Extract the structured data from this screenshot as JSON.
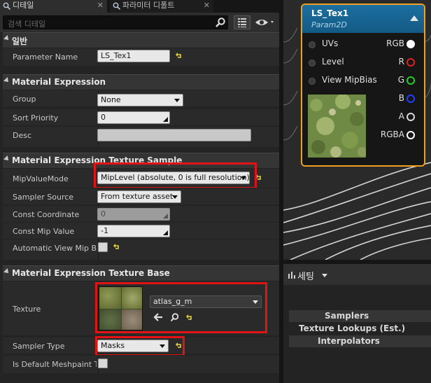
{
  "tabs": [
    {
      "label": "디테일",
      "active": true
    },
    {
      "label": "파라미터 디폴트",
      "active": false
    }
  ],
  "search": {
    "placeholder": "검색 디테일"
  },
  "categories": {
    "general": "일반",
    "expression": "Material Expression",
    "texture_sample": "Material Expression Texture Sample",
    "texture_base": "Material Expression Texture Base"
  },
  "props": {
    "parameter_name": {
      "label": "Parameter Name",
      "value": "LS_Tex1"
    },
    "group": {
      "label": "Group",
      "value": "None"
    },
    "sort_priority": {
      "label": "Sort Priority",
      "value": "0"
    },
    "desc": {
      "label": "Desc",
      "value": ""
    },
    "mip_value_mode": {
      "label": "MipValueMode",
      "value": "MipLevel (absolute, 0 is full resolution)"
    },
    "sampler_source": {
      "label": "Sampler Source",
      "value": "From texture asset"
    },
    "const_coordinate": {
      "label": "Const Coordinate",
      "value": "0"
    },
    "const_mip_value": {
      "label": "Const Mip Value",
      "value": "-1"
    },
    "auto_view_mip_bias": {
      "label": "Automatic View Mip Bias",
      "checked": false
    },
    "texture": {
      "label": "Texture",
      "value": "atlas_g_m"
    },
    "sampler_type": {
      "label": "Sampler Type",
      "value": "Masks"
    },
    "default_meshpaint": {
      "label": "Is Default Meshpaint Texture",
      "checked": false
    }
  },
  "node": {
    "title": "LS_Tex1",
    "subtitle": "Param2D",
    "inputs": [
      "UVs",
      "Level",
      "View MipBias"
    ],
    "outputs": [
      {
        "label": "RGB",
        "color": "#ffffff"
      },
      {
        "label": "R",
        "color": "#e02020"
      },
      {
        "label": "G",
        "color": "#20d020"
      },
      {
        "label": "B",
        "color": "#2040ff"
      },
      {
        "label": "A",
        "color": "#d8d8d8"
      },
      {
        "label": "RGBA",
        "color": "#ffffff"
      }
    ]
  },
  "stats": {
    "title": "세팅",
    "rows": [
      "Samplers",
      "Texture Lookups (Est.)",
      "Interpolators"
    ]
  },
  "colors": {
    "highlight": "#e01414",
    "node_border": "#f0a020",
    "node_header": "#1c6fa0"
  }
}
